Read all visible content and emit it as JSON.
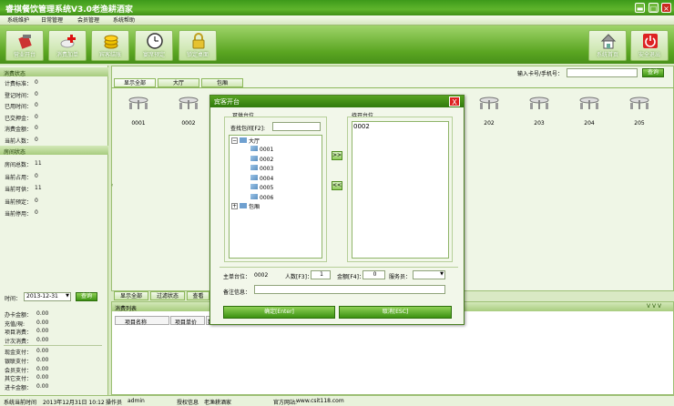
{
  "window": {
    "title": "睿祺餐饮管理系统V3.0老渔耕酒家"
  },
  "menu": [
    "系统维护",
    "日常管理",
    "会员管理",
    "系统帮助"
  ],
  "toolbar": {
    "left": [
      "营业开台",
      "消费加单",
      "宾客结账",
      "宴席预定",
      "锁定桌面"
    ],
    "right": [
      "系统首页",
      "安全退出"
    ]
  },
  "consume_status": {
    "header": "消费状态",
    "rows": [
      {
        "label": "计费标准：",
        "value": "0"
      },
      {
        "label": "登记时间：",
        "value": "0"
      },
      {
        "label": "已用时间：",
        "value": "0"
      },
      {
        "label": "已交押金：",
        "value": "0"
      },
      {
        "label": "消费金额：",
        "value": "0"
      },
      {
        "label": "当前人数：",
        "value": "0"
      }
    ]
  },
  "room_status": {
    "header": "房间状态",
    "rows": [
      {
        "label": "房间总数：",
        "value": "11"
      },
      {
        "label": "当前占用：",
        "value": "0"
      },
      {
        "label": "当前可供：",
        "value": "11"
      },
      {
        "label": "当前预定：",
        "value": "0"
      },
      {
        "label": "当前停用：",
        "value": "0"
      }
    ]
  },
  "date_query": {
    "label": "时间：",
    "date": "2013-12-31",
    "button": "查询"
  },
  "payment_summary": {
    "group1": [
      {
        "label": "办卡金额：",
        "value": "0.00"
      },
      {
        "label": "充值/現:",
        "value": "0.00"
      },
      {
        "label": "项目消费：",
        "value": "0.00"
      },
      {
        "label": "计次消费：",
        "value": "0.00"
      }
    ],
    "group2": [
      {
        "label": "现金支付：",
        "value": "0.00"
      },
      {
        "label": "银联支付：",
        "value": "0.00"
      },
      {
        "label": "会员支付：",
        "value": "0.00"
      },
      {
        "label": "其它支付：",
        "value": "0.00"
      },
      {
        "label": "进卡金额：",
        "value": "0.00"
      }
    ]
  },
  "room_view": {
    "search_label": "输入卡号/手机号：",
    "search_value": "",
    "search_button": "查询",
    "tabs": [
      "显示全部",
      "大厅",
      "包厢"
    ],
    "tables_left": [
      "0001",
      "0002"
    ],
    "tables_right": [
      "202",
      "203",
      "204",
      "205"
    ],
    "bottom_tabs": [
      "显示全部",
      "过滤状态",
      "查看"
    ]
  },
  "consume_list": {
    "header": "消费列表",
    "collapse_glyph": "V V V",
    "columns": [
      "项目名称",
      "项目单价",
      "数"
    ]
  },
  "status_bar": {
    "time_label": "系统当前时间",
    "time_value": "2013年12月31日 10:12",
    "operator_label": "操作员",
    "operator_value": "admin",
    "license_label": "授权信息",
    "license_value": "老渔耕酒家",
    "site_label": "官方网站:",
    "site_value": "www.csit118.com"
  },
  "dialog": {
    "title": "宾客开台",
    "close": "X",
    "available_label": "可供台位",
    "find_label": "查找包间[F2]:",
    "find_value": "",
    "pending_label": "待开台位",
    "pending_items": [
      "0002"
    ],
    "tree": {
      "hall": "大厅",
      "hall_items": [
        "0001",
        "0002",
        "0003",
        "0004",
        "0005",
        "0006"
      ],
      "box": "包厢"
    },
    "add_arrow": ">>",
    "remove_arrow": "<<",
    "main_table_label": "主单台位：",
    "main_table_value": "0002",
    "people_label": "人数[F3]：",
    "people_value": "1",
    "amount_label": "金额[F4]：",
    "amount_value": "0",
    "waiter_label": "服务员：",
    "waiter_value": "",
    "remark_label": "备注信息：",
    "remark_value": "",
    "ok_button": "确定[Enter]",
    "cancel_button": "取消[ESC]"
  },
  "colors": {
    "brand_green": "#5aa521",
    "close_red": "#d22222"
  }
}
